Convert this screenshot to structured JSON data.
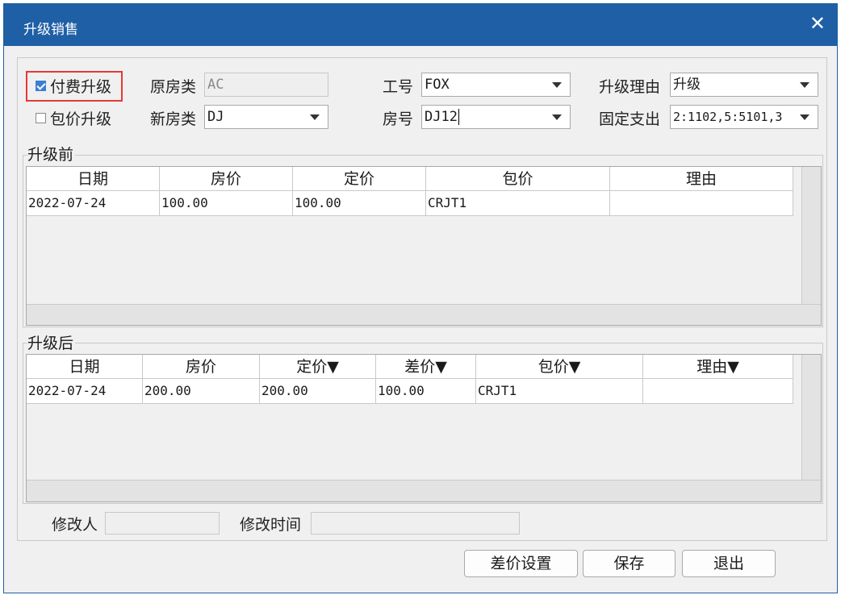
{
  "window": {
    "title": "升级销售",
    "close_glyph": "✕"
  },
  "upgrade_type": {
    "paid": {
      "label": "付费升级",
      "checked": true
    },
    "package": {
      "label": "包价升级",
      "checked": false
    }
  },
  "form": {
    "orig_room_type": {
      "label": "原房类",
      "value": "AC"
    },
    "new_room_type": {
      "label": "新房类",
      "value": "DJ"
    },
    "staff_no": {
      "label": "工号",
      "value": "FOX"
    },
    "room_no": {
      "label": "房号",
      "value": "DJ12"
    },
    "reason": {
      "label": "升级理由",
      "value": "升级"
    },
    "fixed_expense": {
      "label": "固定支出",
      "value": "2:1102,5:5101,3"
    }
  },
  "before": {
    "label": "升级前",
    "columns": [
      "日期",
      "房价",
      "定价",
      "包价",
      "理由"
    ],
    "rows": [
      [
        "2022-07-24",
        "100.00",
        "100.00",
        "CRJT1",
        ""
      ]
    ]
  },
  "after": {
    "label": "升级后",
    "columns": [
      "日期",
      "房价",
      "定价▼",
      "差价▼",
      "包价▼",
      "理由▼"
    ],
    "rows": [
      [
        "2022-07-24",
        "200.00",
        "200.00",
        "100.00",
        "CRJT1",
        ""
      ]
    ]
  },
  "footer": {
    "modifier": {
      "label": "修改人",
      "value": ""
    },
    "modify_time": {
      "label": "修改时间",
      "value": ""
    }
  },
  "buttons": {
    "diff_settings": "差价设置",
    "save": "保存",
    "exit": "退出"
  },
  "colors": {
    "titlebar": "#1f5fa6",
    "highlight_box": "#e53935",
    "checkbox_on": "#3b7fd1"
  }
}
